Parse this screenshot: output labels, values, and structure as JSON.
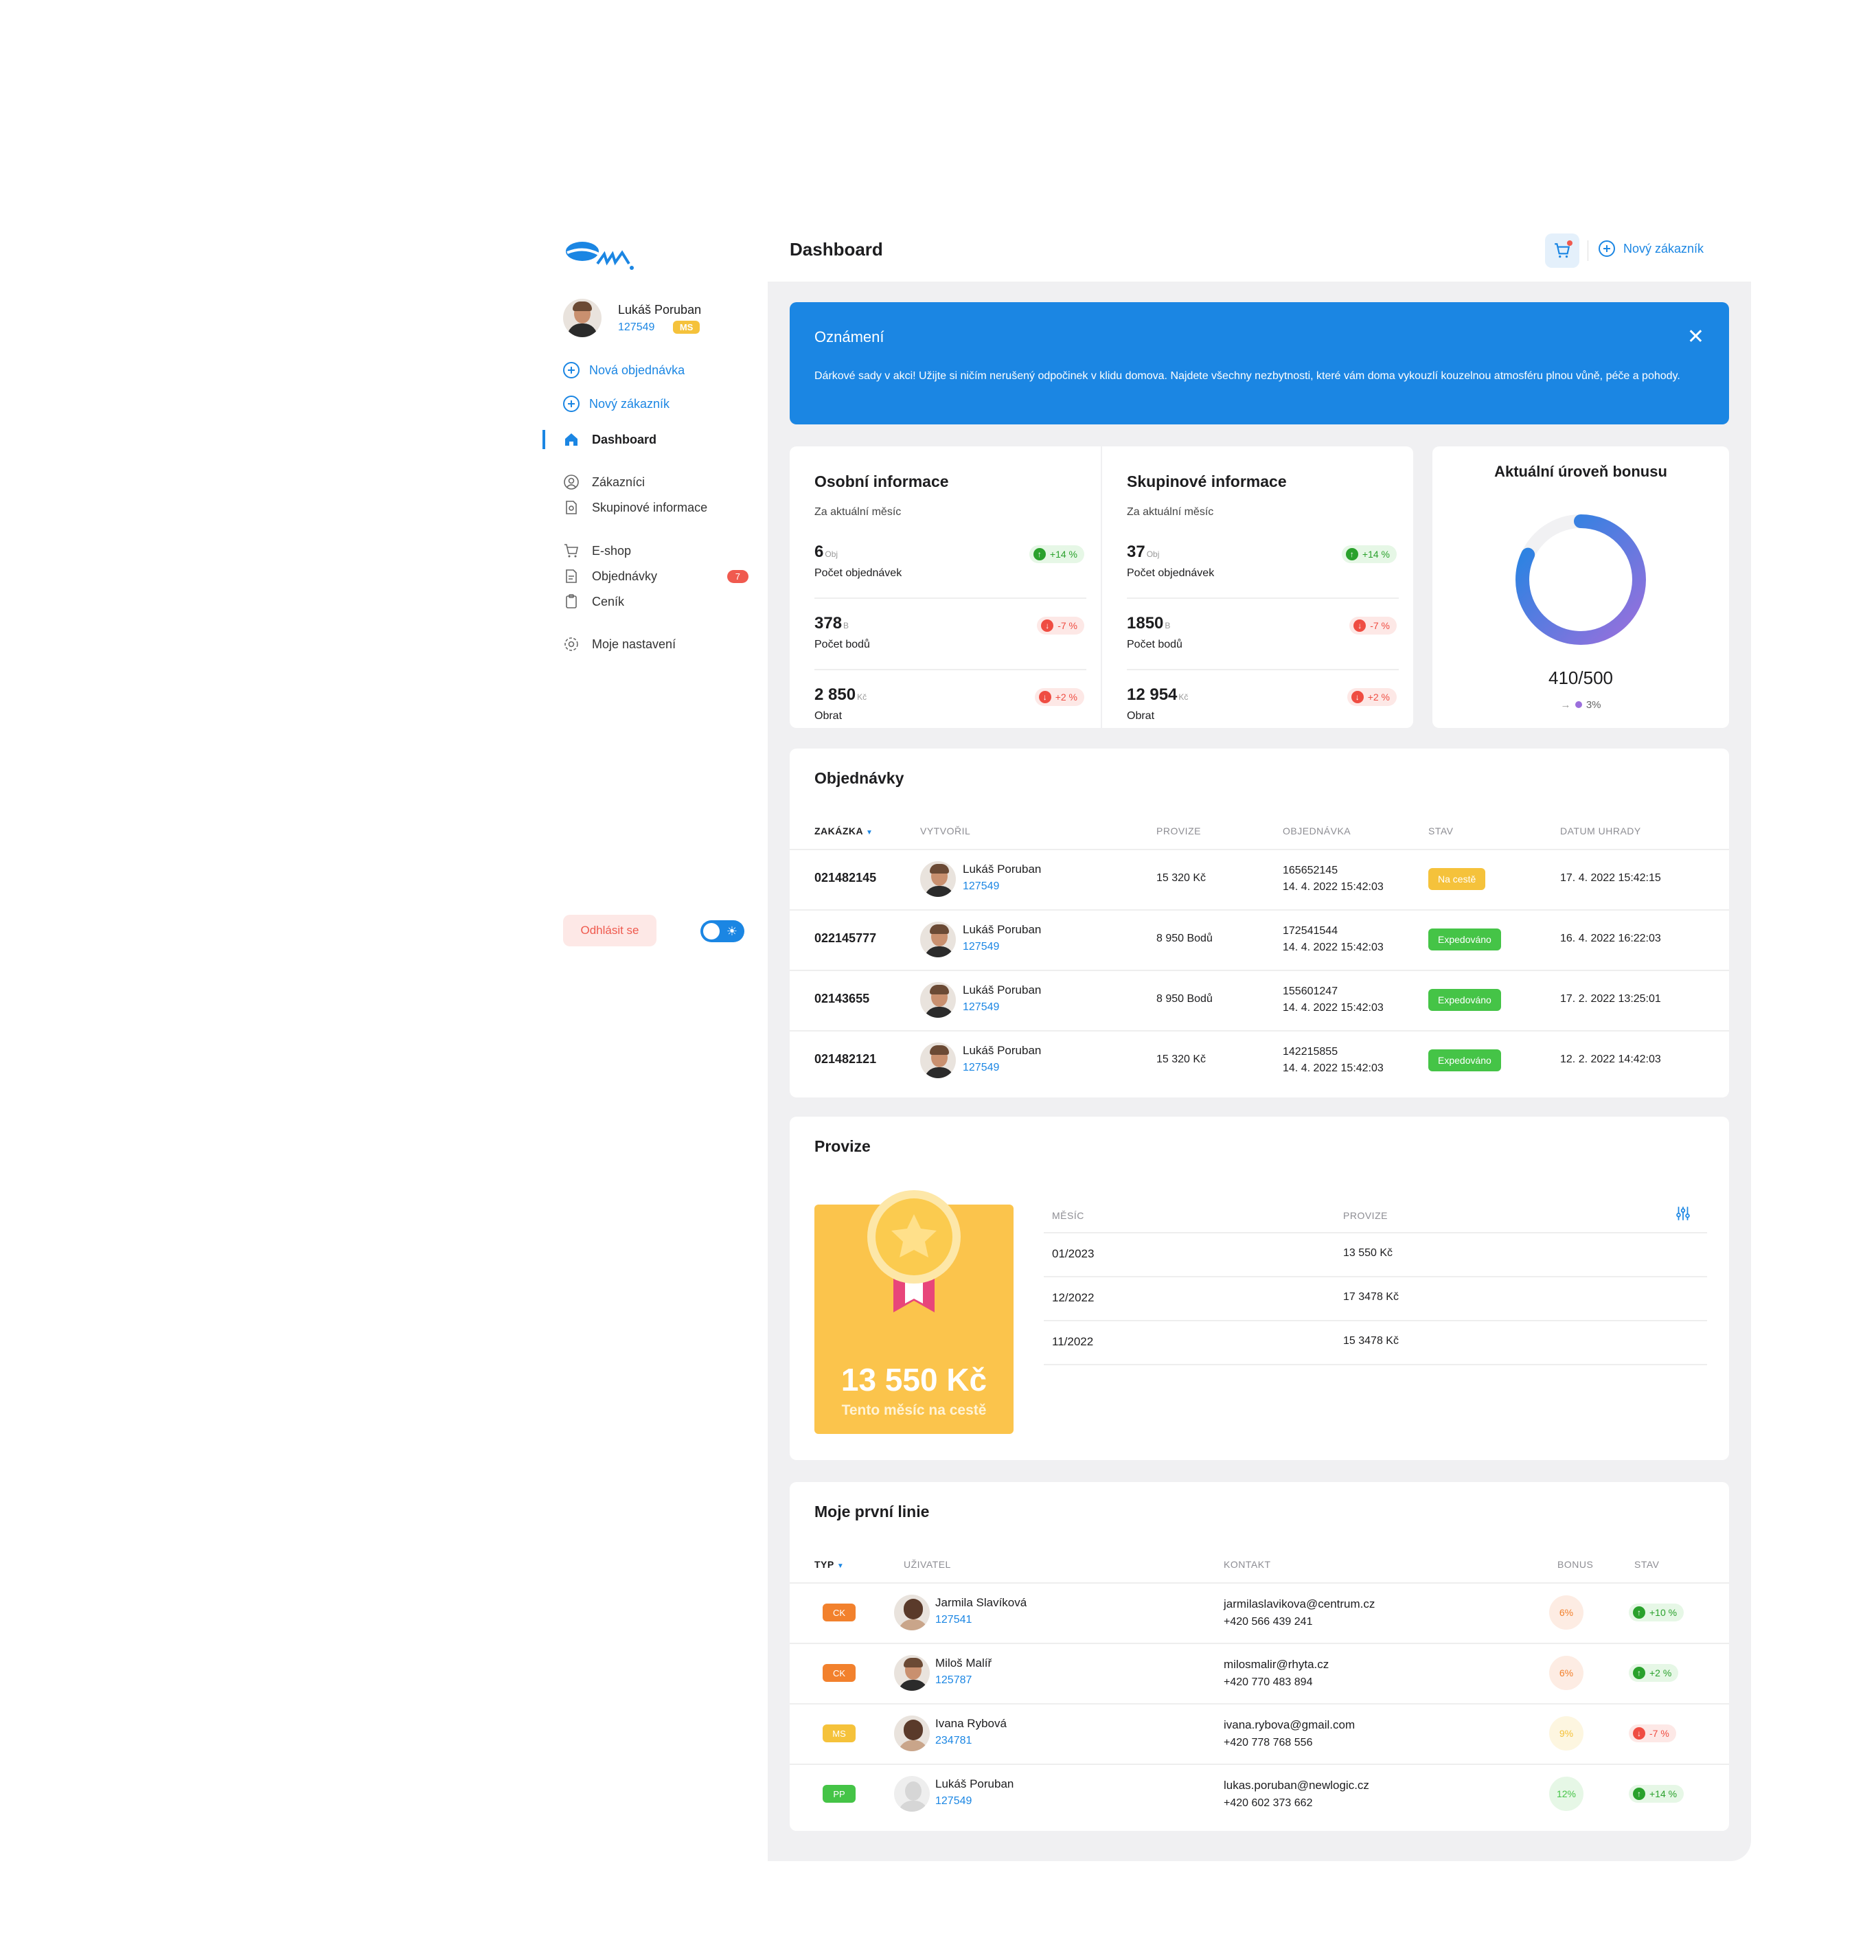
{
  "sidebar": {
    "user": {
      "name": "Lukáš Poruban",
      "id": "127549",
      "badge": "MS"
    },
    "quick_actions": [
      {
        "label": "Nová objednávka",
        "icon": "plus-circle-icon"
      },
      {
        "label": "Nový zákazník",
        "icon": "plus-circle-icon"
      }
    ],
    "nav": [
      {
        "label": "Dashboard",
        "icon": "home-icon",
        "active": true
      },
      {
        "label": "Zákazníci",
        "icon": "user-circle-icon"
      },
      {
        "label": "Skupinové informace",
        "icon": "group-doc-icon"
      },
      {
        "label": "E-shop",
        "icon": "cart-icon"
      },
      {
        "label": "Objednávky",
        "icon": "document-icon",
        "count": "7"
      },
      {
        "label": "Ceník",
        "icon": "clipboard-icon"
      },
      {
        "label": "Moje nastavení",
        "icon": "gear-icon"
      }
    ],
    "logout_label": "Odhlásit se"
  },
  "header": {
    "title": "Dashboard",
    "new_customer_label": "Nový zákazník"
  },
  "notice": {
    "title": "Oznámení",
    "text": "Dárkové sady v akci! Užijte si ničím nerušený odpočinek v klidu domova. Najdete všechny nezbytnosti, které vám doma vykouzlí kouzelnou atmosféru plnou vůně, péče a pohody."
  },
  "personal": {
    "title": "Osobní informace",
    "subtitle": "Za aktuální měsíc",
    "stats": [
      {
        "value": "6",
        "unit": "Obj",
        "label": "Počet objednávek",
        "change": "+14 %",
        "dir": "up"
      },
      {
        "value": "378",
        "unit": "B",
        "label": "Počet bodů",
        "change": "-7 %",
        "dir": "down"
      },
      {
        "value": "2 850",
        "unit": "Kč",
        "label": "Obrat",
        "change": "+2 %",
        "dir": "down"
      }
    ]
  },
  "group": {
    "title": "Skupinové informace",
    "subtitle": "Za aktuální měsíc",
    "stats": [
      {
        "value": "37",
        "unit": "Obj",
        "label": "Počet objednávek",
        "change": "+14 %",
        "dir": "up"
      },
      {
        "value": "1850",
        "unit": "B",
        "label": "Počet bodů",
        "change": "-7 %",
        "dir": "down"
      },
      {
        "value": "12 954",
        "unit": "Kč",
        "label": "Obrat",
        "change": "+2 %",
        "dir": "down"
      }
    ]
  },
  "bonus": {
    "title": "Aktuální úroveň bonusu",
    "value_text": "410/500",
    "progress": 0.82,
    "trend_arrow": "→",
    "trend_pct": "3%",
    "colors": {
      "ring_start": "#9b6fdc",
      "ring_end": "#1b86e3",
      "track": "#f1f1f3"
    }
  },
  "orders": {
    "title": "Objednávky",
    "columns": [
      "ZAKÁZKA",
      "VYTVOŘIL",
      "PROVIZE",
      "OBJEDNÁVKA",
      "STAV",
      "DATUM UHRADY"
    ],
    "rows": [
      {
        "id": "021482145",
        "creator": "Lukáš Poruban",
        "creator_id": "127549",
        "provize": "15 320 Kč",
        "order_no": "165652145",
        "order_date": "14. 4. 2022  15:42:03",
        "status": "Na cestě",
        "status_color": "orange",
        "paid": "17. 4. 2022  15:42:15"
      },
      {
        "id": "022145777",
        "creator": "Lukáš Poruban",
        "creator_id": "127549",
        "provize": "8 950 Bodů",
        "order_no": "172541544",
        "order_date": "14. 4. 2022  15:42:03",
        "status": "Expedováno",
        "status_color": "green",
        "paid": "16. 4. 2022  16:22:03"
      },
      {
        "id": "02143655",
        "creator": "Lukáš Poruban",
        "creator_id": "127549",
        "provize": "8 950 Bodů",
        "order_no": "155601247",
        "order_date": "14. 4. 2022  15:42:03",
        "status": "Expedováno",
        "status_color": "green",
        "paid": "17. 2. 2022  13:25:01"
      },
      {
        "id": "021482121",
        "creator": "Lukáš Poruban",
        "creator_id": "127549",
        "provize": "15 320 Kč",
        "order_no": "142215855",
        "order_date": "14. 4. 2022  15:42:03",
        "status": "Expedováno",
        "status_color": "green",
        "paid": "12. 2. 2022  14:42:03"
      }
    ]
  },
  "provize": {
    "title": "Provize",
    "hero_amount": "13 550 Kč",
    "hero_caption": "Tento měsíc na cestě",
    "columns": [
      "MĚSÍC",
      "PROVIZE"
    ],
    "rows": [
      {
        "month": "01/2023",
        "amount": "13 550 Kč"
      },
      {
        "month": "12/2022",
        "amount": "17 3478 Kč"
      },
      {
        "month": "11/2022",
        "amount": "15 3478 Kč"
      }
    ]
  },
  "line": {
    "title": "Moje první linie",
    "columns": [
      "TYP",
      "UŽIVATEL",
      "KONTAKT",
      "BONUS",
      "STAV"
    ],
    "rows": [
      {
        "type": "CK",
        "type_color": "orange",
        "name": "Jarmila Slavíková",
        "id": "127541",
        "email": "jarmilaslavikova@centrum.cz",
        "phone": "+420 566 439 241",
        "bonus": "6%",
        "bonus_color": "orange",
        "change": "+10 %",
        "dir": "up",
        "avatar": "female"
      },
      {
        "type": "CK",
        "type_color": "orange",
        "name": "Miloš Malíř",
        "id": "125787",
        "email": "milosmalir@rhyta.cz",
        "phone": "+420 770 483 894",
        "bonus": "6%",
        "bonus_color": "orange",
        "change": "+2 %",
        "dir": "up",
        "avatar": "male"
      },
      {
        "type": "MS",
        "type_color": "yellow",
        "name": "Ivana Rybová",
        "id": "234781",
        "email": "ivana.rybova@gmail.com",
        "phone": "+420 778 768 556",
        "bonus": "9%",
        "bonus_color": "yellow",
        "change": "-7 %",
        "dir": "down",
        "avatar": "female"
      },
      {
        "type": "PP",
        "type_color": "green",
        "name": "Lukáš Poruban",
        "id": "127549",
        "email": "lukas.poruban@newlogic.cz",
        "phone": "+420 602 373 662",
        "bonus": "12%",
        "bonus_color": "green",
        "change": "+14 %",
        "dir": "up",
        "avatar": "placeholder"
      }
    ]
  }
}
